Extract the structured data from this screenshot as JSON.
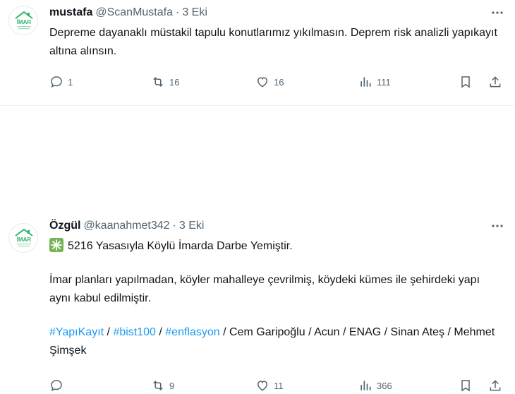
{
  "tweets": [
    {
      "name": "mustafa",
      "handle": "@ScanMustafa",
      "separator": "·",
      "date": "3 Eki",
      "lines": [
        "Depreme dayanaklı müstakil tapulu konutlarımız yıkılmasın. Deprem risk analizli yapıkayıt altına alınsın."
      ],
      "stats": {
        "replies": "1",
        "reposts": "16",
        "likes": "16",
        "views": "111"
      }
    },
    {
      "name": "Özgül",
      "handle": "@kaanahmet342",
      "separator": "·",
      "date": "3 Eki",
      "emoji_icon": "sparkle-emoji-icon",
      "heading": "5216 Yasasıyla Köylü İmarda Darbe Yemiştir.",
      "paragraph": "İmar planları yapılmadan, köyler mahalleye çevrilmiş, köydeki kümes ile şehirdeki yapı aynı kabul edilmiştir.",
      "hashtags": [
        "#YapıKayıt",
        "#bist100",
        "#enflasyon"
      ],
      "slash": " / ",
      "tail": "Cem Garipoğlu / Acun / ENAG / Sinan Ateş / Mehmet Şimşek",
      "stats": {
        "replies": "",
        "reposts": "9",
        "likes": "11",
        "views": "366"
      }
    }
  ],
  "avatar_text": "İMAR",
  "colors": {
    "link": "#1d9bf0",
    "secondary": "#536471",
    "avatar_green": "#2fb56a"
  }
}
